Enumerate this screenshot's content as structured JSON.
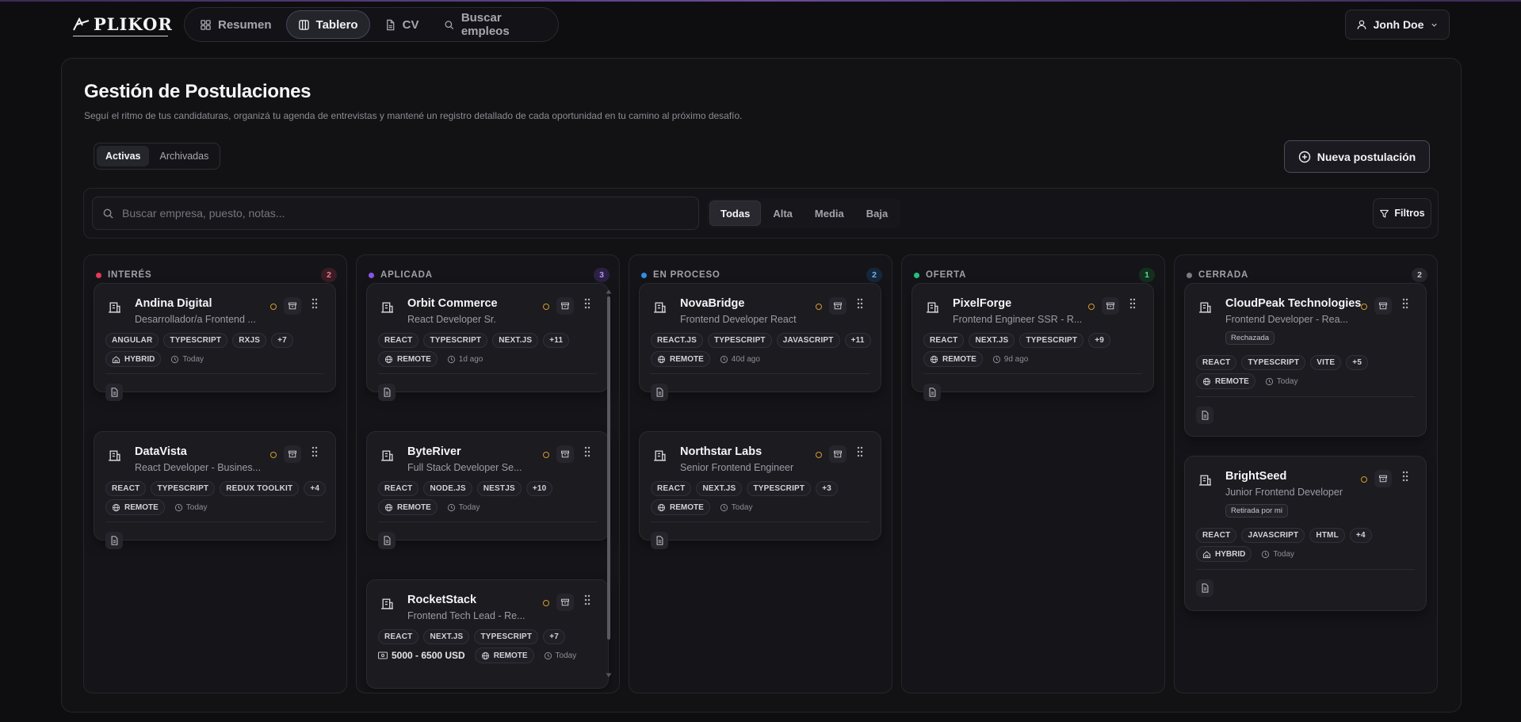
{
  "nav": {
    "logo": "PLIKOR",
    "items": [
      {
        "label": "Resumen",
        "icon": "grid-icon",
        "active": false
      },
      {
        "label": "Tablero",
        "icon": "kanban-icon",
        "active": true
      },
      {
        "label": "CV",
        "icon": "file-icon",
        "active": false
      },
      {
        "label": "Buscar empleos",
        "icon": "search-icon",
        "active": false
      }
    ],
    "user": "Jonh Doe"
  },
  "header": {
    "title": "Gestión de Postulaciones",
    "subtitle": "Seguí el ritmo de tus candidaturas, organizá tu agenda de entrevistas y mantené un registro detallado de cada oportunidad en tu camino al próximo desafío.",
    "tabs": [
      "Activas",
      "Archivadas"
    ],
    "new_button": "Nueva postulación"
  },
  "toolbar": {
    "search_placeholder": "Buscar empresa, puesto, notas...",
    "priorities": [
      "Todas",
      "Alta",
      "Media",
      "Baja"
    ],
    "filters": "Filtros"
  },
  "colors": {
    "interes": "#e23b55",
    "aplicada": "#8a55e8",
    "proceso": "#2f8fe6",
    "oferta": "#22c37a",
    "cerrada": "#7c7c84",
    "priority": "#d49b2b"
  },
  "columns": [
    {
      "name": "INTERÉS",
      "count": "2",
      "cards": [
        {
          "company": "Andina Digital",
          "role": "Desarrollador/a Frontend ...",
          "tags": [
            "ANGULAR",
            "TYPESCRIPT",
            "RXJS",
            "+7"
          ],
          "mode": "HYBRID",
          "time": "Today"
        },
        {
          "company": "DataVista",
          "role": "React Developer - Busines...",
          "tags": [
            "REACT",
            "TYPESCRIPT",
            "REDUX TOOLKIT",
            "+4"
          ],
          "mode": "REMOTE",
          "time": "Today"
        }
      ]
    },
    {
      "name": "APLICADA",
      "count": "3",
      "cards": [
        {
          "company": "Orbit Commerce",
          "role": "React Developer Sr.",
          "tags": [
            "REACT",
            "TYPESCRIPT",
            "NEXT.JS",
            "+11"
          ],
          "mode": "REMOTE",
          "time": "1d ago"
        },
        {
          "company": "ByteRiver",
          "role": "Full Stack Developer Se...",
          "tags": [
            "REACT",
            "NODE.JS",
            "NESTJS",
            "+10"
          ],
          "mode": "REMOTE",
          "time": "Today"
        },
        {
          "company": "RocketStack",
          "role": "Frontend Tech Lead - Re...",
          "tags": [
            "REACT",
            "NEXT.JS",
            "TYPESCRIPT",
            "+7"
          ],
          "salary": "5000 - 6500 USD",
          "mode": "REMOTE",
          "time": "Today"
        }
      ]
    },
    {
      "name": "EN PROCESO",
      "count": "2",
      "cards": [
        {
          "company": "NovaBridge",
          "role": "Frontend Developer React",
          "tags": [
            "REACT.JS",
            "TYPESCRIPT",
            "JAVASCRIPT",
            "+11"
          ],
          "mode": "REMOTE",
          "time": "40d ago"
        },
        {
          "company": "Northstar Labs",
          "role": "Senior Frontend Engineer",
          "tags": [
            "REACT",
            "NEXT.JS",
            "TYPESCRIPT",
            "+3"
          ],
          "mode": "REMOTE",
          "time": "Today"
        }
      ]
    },
    {
      "name": "OFERTA",
      "count": "1",
      "cards": [
        {
          "company": "PixelForge",
          "role": "Frontend Engineer SSR - R...",
          "tags": [
            "REACT",
            "NEXT.JS",
            "TYPESCRIPT",
            "+9"
          ],
          "mode": "REMOTE",
          "time": "9d ago"
        }
      ]
    },
    {
      "name": "CERRADA",
      "count": "2",
      "cards": [
        {
          "company": "CloudPeak Technologies",
          "role": "Frontend Developer - Rea...",
          "badge": "Rechazada",
          "tags": [
            "REACT",
            "TYPESCRIPT",
            "VITE",
            "+5"
          ],
          "mode": "REMOTE",
          "time": "Today"
        },
        {
          "company": "BrightSeed",
          "role": "Junior Frontend Developer",
          "badge": "Retirada por mi",
          "tags": [
            "REACT",
            "JAVASCRIPT",
            "HTML",
            "+4"
          ],
          "mode": "HYBRID",
          "time": "Today"
        }
      ]
    }
  ]
}
